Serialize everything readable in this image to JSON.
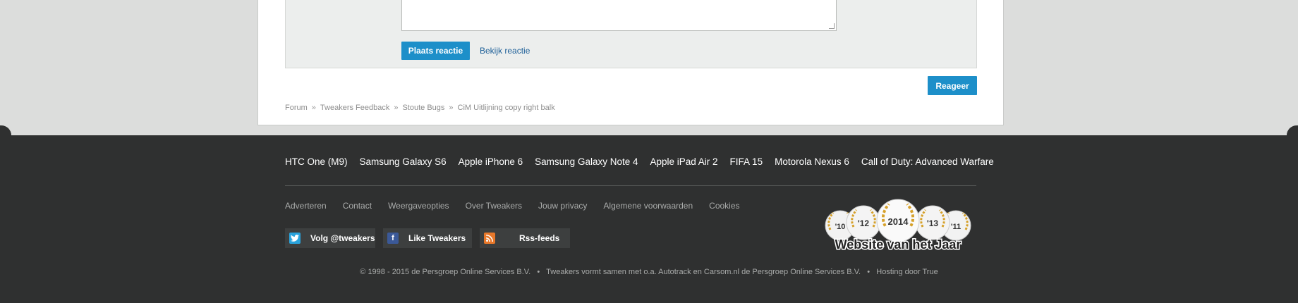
{
  "reply": {
    "submit_label": "Plaats reactie",
    "preview_label": "Bekijk reactie"
  },
  "reageer_label": "Reageer",
  "breadcrumb": [
    "Forum",
    "Tweakers Feedback",
    "Stoute Bugs",
    "CiM Uitlijning copy right balk"
  ],
  "breadcrumb_separator": "»",
  "footer": {
    "products": [
      "HTC One (M9)",
      "Samsung Galaxy S6",
      "Apple iPhone 6",
      "Samsung Galaxy Note 4",
      "Apple iPad Air 2",
      "FIFA 15",
      "Motorola Nexus 6",
      "Call of Duty: Advanced Warfare"
    ],
    "links": [
      "Adverteren",
      "Contact",
      "Weergaveopties",
      "Over Tweakers",
      "Jouw privacy",
      "Algemene voorwaarden",
      "Cookies"
    ],
    "social": {
      "twitter_label": "Volg @tweakers",
      "facebook_label": "Like Tweakers",
      "rss_label": "Rss-feeds"
    },
    "award": {
      "years": [
        "'10",
        "'12",
        "2014",
        "'13",
        "'11"
      ],
      "text": "Website van het Jaar"
    },
    "copyright": "© 1998 - 2015 de Persgroep Online Services B.V.   •   Tweakers vormt samen met o.a. Autotrack en Carsom.nl de Persgroep Online Services B.V.   •   Hosting door True"
  },
  "colors": {
    "accent": "#1d8fc9",
    "footer_bg": "#2f3030",
    "twitter": "#2aa3dc",
    "facebook": "#3b5998",
    "rss": "#e8782a"
  }
}
